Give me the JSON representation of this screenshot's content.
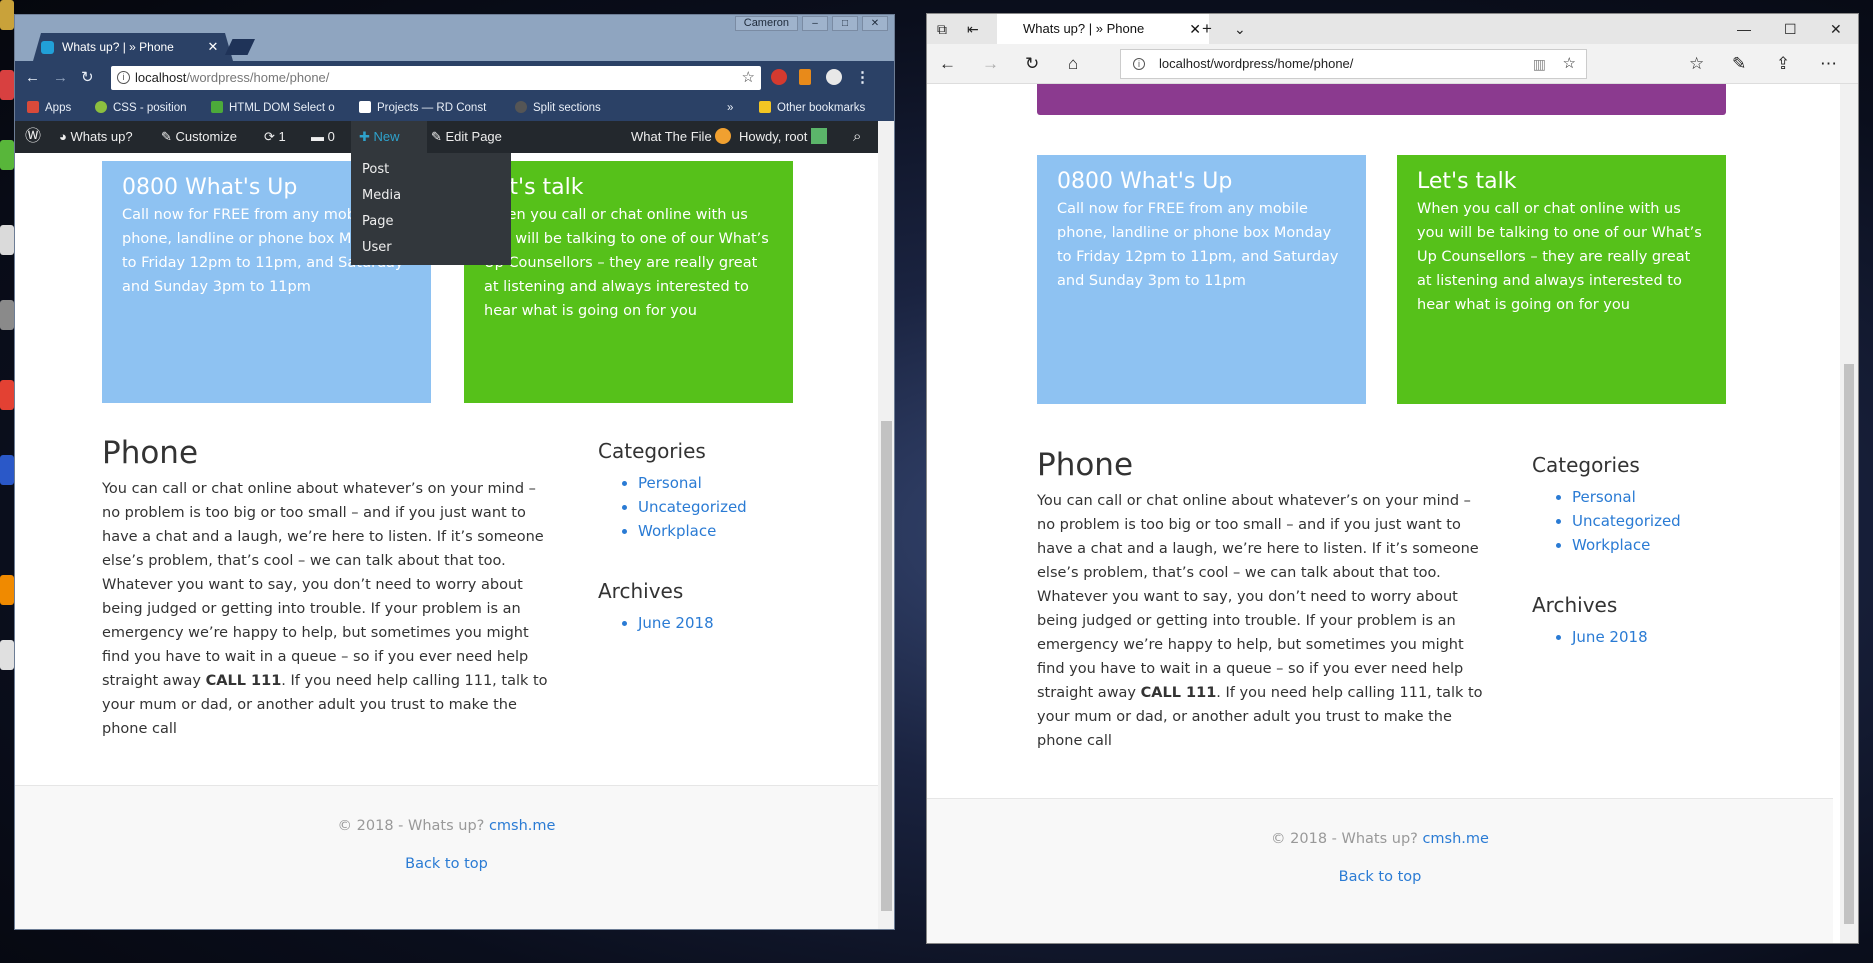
{
  "desktop": {
    "icons": [
      {
        "name": "desktop-icon-folder",
        "color": "#c9a23a"
      },
      {
        "name": "desktop-icon-app",
        "color": "#d84040"
      },
      {
        "name": "desktop-icon-utorrent",
        "color": "#58b63a"
      },
      {
        "name": "desktop-icon-drive",
        "color": "#dadada"
      },
      {
        "name": "desktop-icon-explorer",
        "color": "#8a8a8a"
      },
      {
        "name": "desktop-icon-chrome",
        "color": "#e34133"
      },
      {
        "name": "desktop-icon-shortcut",
        "color": "#2a58c8"
      },
      {
        "name": "desktop-icon-vlc",
        "color": "#f08a00"
      },
      {
        "name": "desktop-icon-other",
        "color": "#e0e0e0"
      }
    ]
  },
  "chrome": {
    "user": "Cameron",
    "tab_title": "Whats up? | » Phone",
    "url_host": "localhost",
    "url_path": "/wordpress/home/phone/",
    "bookmarks": [
      "Apps",
      "CSS - position",
      "HTML DOM Select o",
      "Projects — RD Const",
      "Split sections",
      "Other bookmarks"
    ],
    "bookmarks_more": "»",
    "colors": {
      "frame": "#2b4166",
      "tabbar": "#8fa5c0"
    }
  },
  "wp_admin_bar": {
    "site_name": "Whats up?",
    "customize": "Customize",
    "updates_count": "1",
    "comments_count": "0",
    "new_label": "New",
    "edit_page": "Edit Page",
    "plugin": "What The File",
    "howdy": "Howdy, root",
    "new_menu": [
      "Post",
      "Media",
      "Page",
      "User"
    ]
  },
  "page": {
    "box_blue": {
      "title": "0800 What's Up",
      "text": "Call now for FREE from any mobile phone, landline or phone box Monday to Friday 12pm to 11pm, and Saturday and Sunday 3pm to 11pm"
    },
    "box_green": {
      "title": "Let's talk",
      "text": "When you call or chat online with us you will be talking to one of our What’s Up Counsellors – they are really great at listening and always interested to hear what is going on for you"
    },
    "title": "Phone",
    "body_before": "You can call or chat online about whatever’s on your mind – no problem is too big or too small – and if you just want to have a chat and a laugh, we’re here to listen. If it’s someone else’s problem, that’s cool – we can talk about that too. Whatever you want to say, you don’t need to worry about being judged or getting into trouble. If your problem is an emergency we’re happy to help, but sometimes you might find you have to wait in a queue – so if you ever need help straight away ",
    "body_bold": "CALL 111",
    "body_after": ". If you need help calling 111, talk to your mum or dad, or another adult you trust to make the phone call",
    "categories_title": "Categories",
    "categories": [
      "Personal",
      "Uncategorized",
      "Workplace"
    ],
    "archives_title": "Archives",
    "archives": [
      "June 2018"
    ],
    "footer_copy": "© 2018 - Whats up?",
    "footer_link": "cmsh.me",
    "back_to_top": "Back to top",
    "colors": {
      "blue_box": "#8ec2f2",
      "green_box": "#56c11a",
      "link": "#2a7bd4",
      "purple_bar": "#8b3a8f"
    }
  },
  "edge": {
    "tab_title": "Whats up? | » Phone",
    "url": "localhost/wordpress/home/phone/"
  }
}
